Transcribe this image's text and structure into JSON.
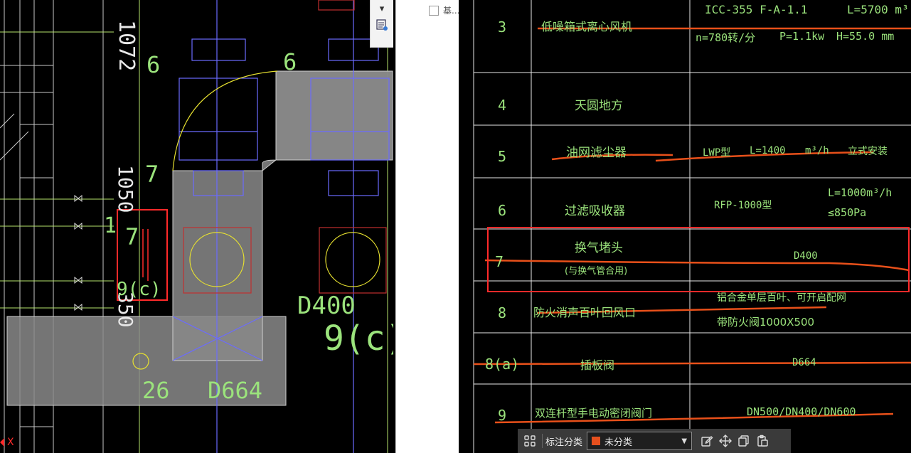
{
  "left_drawing": {
    "dims": [
      "1072",
      "1050",
      "350"
    ],
    "labels": [
      "6",
      "6",
      "7",
      "7",
      "1",
      "9(c)",
      "D400",
      "9(c)",
      "26",
      "D664"
    ],
    "axis_label": "X"
  },
  "toolbar": {
    "dropdown_icon": "chevron-down-icon",
    "layer_icon": "layer-list-icon"
  },
  "middle_panel": {
    "checkbox_label": "基..."
  },
  "table": {
    "rows": [
      {
        "no": "3",
        "name": "低噪箱式离心风机",
        "spec1": "ICC-355 F-A-1.1",
        "spec2": "L=5700 m³",
        "spec3": "n=780转/分",
        "spec4": "P=1.1kw",
        "spec5": "H=55.0 mm"
      },
      {
        "no": "4",
        "name": "天圆地方"
      },
      {
        "no": "5",
        "name": "油网滤尘器",
        "spec1": "LWP型",
        "spec2": "L=1400",
        "spec3": "m³/h",
        "spec4": "立式安装"
      },
      {
        "no": "6",
        "name": "过滤吸收器",
        "spec1": "RFP-1000型",
        "spec2": "L=1000m³/h",
        "spec3": "≤850Pa"
      },
      {
        "no": "7",
        "name": "换气堵头",
        "sub": "(与换气管合用)",
        "spec1": "D400"
      },
      {
        "no": "8",
        "name": "防火消声百叶回风口",
        "spec1": "铝合金单层百叶、可开启配网",
        "spec2": "带防火阀1000X500"
      },
      {
        "no": "8(a)",
        "name": "插板阀",
        "spec1": "D664"
      },
      {
        "no": "9",
        "name": "双连杆型手电动密闭阀门",
        "spec1": "DN500/DN400/DN600"
      }
    ]
  },
  "bottom_toolbar": {
    "label": "标注分类",
    "selected": "未分类",
    "swatch_color": "#e6501e"
  },
  "colors": {
    "cad_bg": "#000000",
    "green_text": "#9be37c",
    "white_text": "#e8e8e8",
    "markup_orange": "#e8501a",
    "markup_red": "#ff2a2a"
  }
}
